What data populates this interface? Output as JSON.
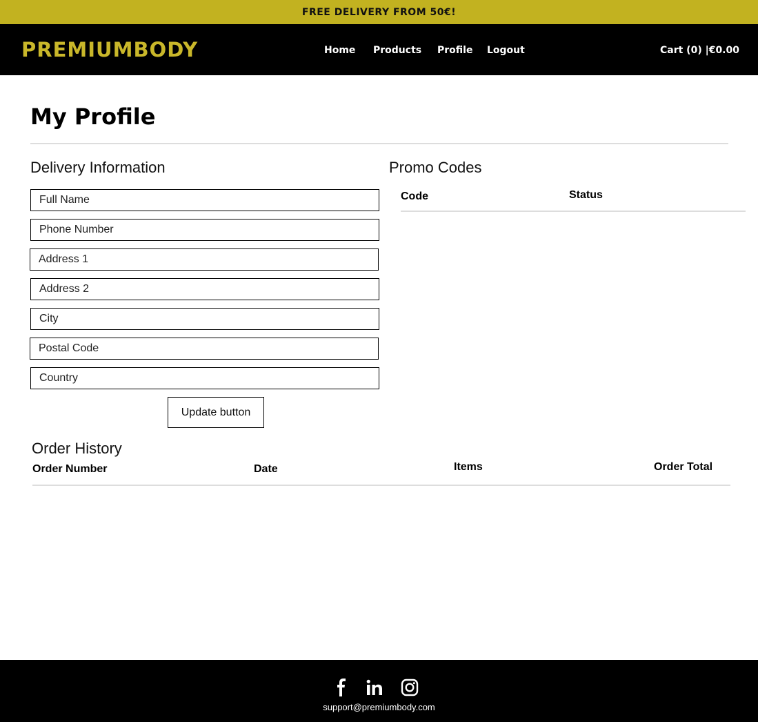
{
  "banner": {
    "text": "FREE DELIVERY FROM 50€!"
  },
  "header": {
    "logo": "PREMIUMBODY",
    "nav": {
      "home": "Home",
      "products": "Products",
      "profile": "Profile",
      "logout": "Logout"
    },
    "cart": "Cart (0) |€0.00"
  },
  "page": {
    "title": "My Profile"
  },
  "delivery": {
    "title": "Delivery Information",
    "fields": {
      "full_name": "Full Name",
      "phone": "Phone Number",
      "address1": "Address 1",
      "address2": "Address 2",
      "city": "City",
      "postal_code": "Postal Code",
      "country": "Country"
    },
    "update_label": "Update button"
  },
  "promo": {
    "title": "Promo Codes",
    "columns": {
      "code": "Code",
      "status": "Status"
    }
  },
  "orders": {
    "title": "Order History",
    "columns": {
      "number": "Order Number",
      "date": "Date",
      "items": "Items",
      "total": "Order Total"
    }
  },
  "footer": {
    "icons": [
      "facebook-icon",
      "linkedin-icon",
      "instagram-icon"
    ],
    "email": "support@premiumbody.com"
  },
  "colors": {
    "brand": "#c2b220",
    "logo": "#c9b72a",
    "nav_bg": "#000000"
  }
}
